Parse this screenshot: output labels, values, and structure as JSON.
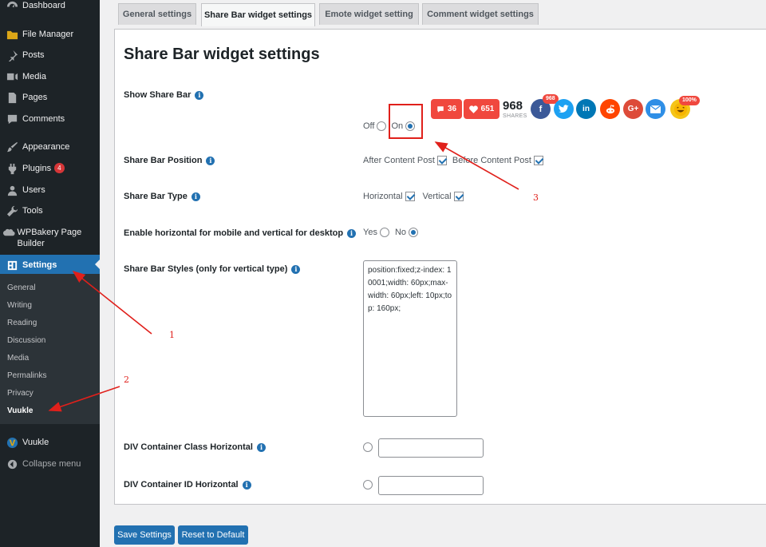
{
  "sidebar": {
    "items": [
      {
        "label": "Dashboard",
        "icon": "dashboard-icon"
      },
      {
        "label": "File Manager",
        "icon": "folder-icon"
      },
      {
        "label": "Posts",
        "icon": "pushpin-icon"
      },
      {
        "label": "Media",
        "icon": "media-icon"
      },
      {
        "label": "Pages",
        "icon": "pages-icon"
      },
      {
        "label": "Comments",
        "icon": "comment-icon"
      },
      {
        "label": "Appearance",
        "icon": "paintbrush-icon"
      },
      {
        "label": "Plugins",
        "icon": "plugin-icon",
        "badge": "4"
      },
      {
        "label": "Users",
        "icon": "user-icon"
      },
      {
        "label": "Tools",
        "icon": "wrench-icon"
      },
      {
        "label": "WPBakery Page Builder",
        "icon": "wpbakery-icon"
      },
      {
        "label": "Settings",
        "icon": "settings-icon"
      },
      {
        "label": "Vuukle",
        "icon": "vuukle-logo-icon"
      },
      {
        "label": "Collapse menu",
        "icon": "collapse-icon"
      }
    ],
    "submenu": [
      "General",
      "Writing",
      "Reading",
      "Discussion",
      "Media",
      "Permalinks",
      "Privacy",
      "Vuukle"
    ],
    "active_color": "#2271b1"
  },
  "tabs": [
    "General settings",
    "Share Bar widget settings",
    "Emote widget setting",
    "Comment widget settings"
  ],
  "heading": "Share Bar widget settings",
  "rows": {
    "show_share_bar": {
      "label": "Show Share Bar",
      "off": "Off",
      "on": "On",
      "selected": "On"
    },
    "position": {
      "label": "Share Bar Position",
      "after": "After Content Post",
      "before": "Before Content Post"
    },
    "type": {
      "label": "Share Bar Type",
      "horizontal": "Horizontal",
      "vertical": "Vertical"
    },
    "mobile": {
      "label": "Enable horizontal for mobile and vertical for desktop",
      "yes": "Yes",
      "no": "No",
      "selected": "No"
    },
    "styles": {
      "label": "Share Bar Styles (only for vertical type)",
      "value": "position:fixed;z-index: 10001;width: 60px;max-width: 60px;left: 10px;top: 160px;"
    },
    "class_horizontal": {
      "label": "DIV Container Class Horizontal"
    },
    "id_horizontal": {
      "label": "DIV Container ID Horizontal"
    }
  },
  "preview": {
    "comments": "36",
    "likes": "651",
    "shares": "968",
    "shares_label": "SHARES",
    "facebook_badge": "968",
    "emote_badge": "100%",
    "google_label": "G+",
    "brand_red": "#f0483e"
  },
  "buttons": {
    "save": "Save Settings",
    "reset": "Reset to Default"
  },
  "annotations": {
    "one": "1",
    "two": "2",
    "three": "3",
    "color": "#e0201b"
  }
}
